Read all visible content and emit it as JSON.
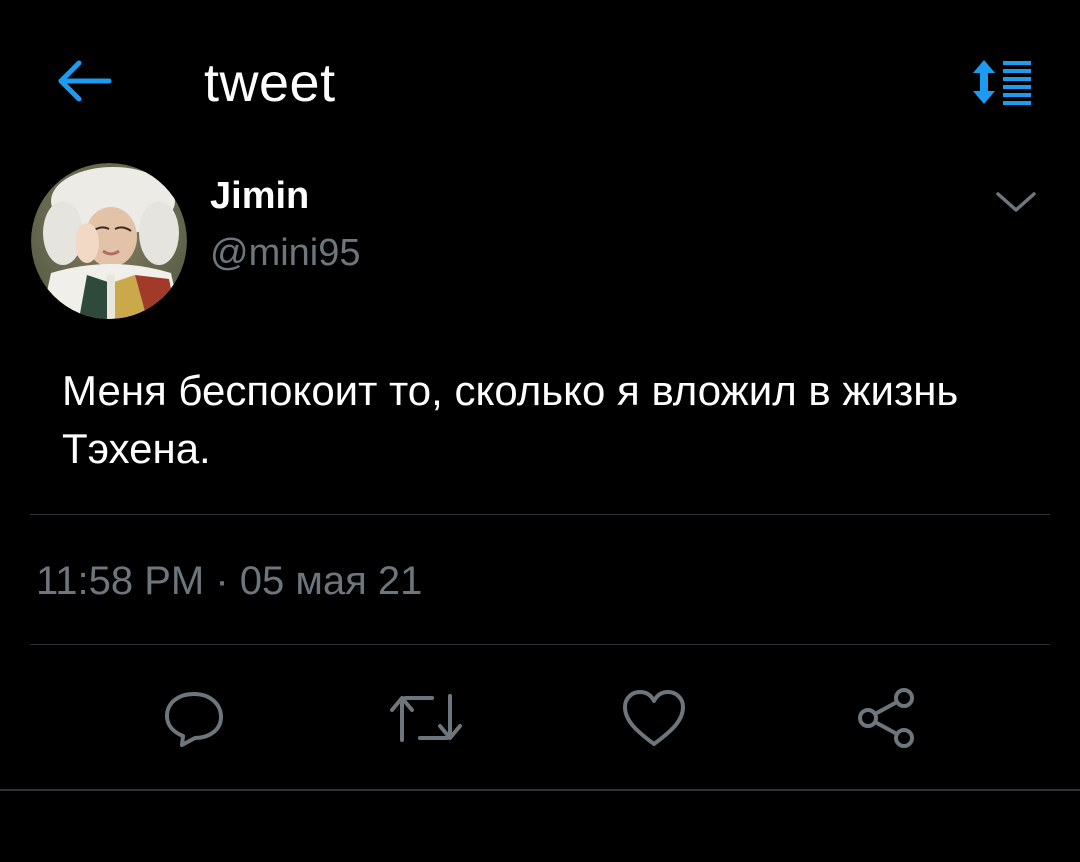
{
  "header": {
    "title": "tweet",
    "back_icon": "arrow-left-icon",
    "sort_icon": "sort-list-icon"
  },
  "author": {
    "display_name": "Jimin",
    "handle": "@mini95",
    "avatar_icon": "avatar"
  },
  "tweet": {
    "text": "Меня беспокоит то, сколько я вложил в жизнь Тэхена.",
    "timestamp": "11:58 PM · 05 мая 21"
  },
  "actions": [
    {
      "name": "reply",
      "icon": "reply-icon"
    },
    {
      "name": "retweet",
      "icon": "retweet-icon"
    },
    {
      "name": "like",
      "icon": "heart-icon"
    },
    {
      "name": "share",
      "icon": "share-icon"
    }
  ],
  "colors": {
    "background": "#000000",
    "accent": "#1d9bf0",
    "secondary_text": "#6e767d",
    "divider": "#2f3336"
  }
}
